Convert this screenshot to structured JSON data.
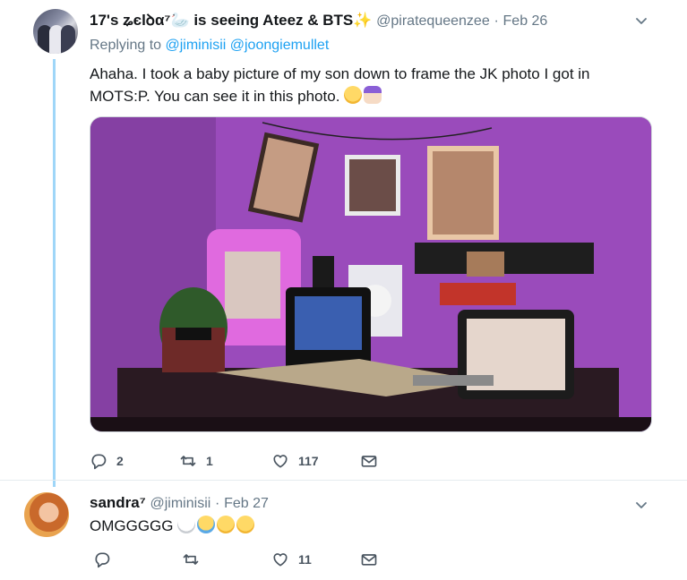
{
  "tweets": [
    {
      "display_name": "17's ʑєlꝺα⁷🦢 is seeing Ateez & BTS✨",
      "handle": "@piratequeenzee",
      "separator": "·",
      "date": "Feb 26",
      "replying_prefix": "Replying to",
      "replying_to": [
        "@jiminisii",
        "@joongiemullet"
      ],
      "text": "Ahaha. I took a baby picture of my son down to frame the JK photo I got in MOTS:P. You can see it in this photo.",
      "text_emojis": [
        "laughing-tears-emoji",
        "shrug-emoji"
      ],
      "actions": {
        "replies": "2",
        "retweets": "1",
        "likes": "117"
      }
    },
    {
      "display_name": "sandra⁷",
      "handle": "@jiminisii",
      "separator": "·",
      "date": "Feb 27",
      "text": "OMGGGGG",
      "text_emojis": [
        "skull-emoji",
        "crying-emoji",
        "laughing-tears-emoji",
        "laughing-tears-emoji"
      ],
      "actions": {
        "replies": "",
        "retweets": "",
        "likes": "11"
      }
    }
  ],
  "icons": {
    "reply": "reply-icon",
    "retweet": "retweet-icon",
    "like": "heart-icon",
    "dm": "envelope-icon",
    "menu": "chevron-down-icon"
  },
  "colors": {
    "link": "#1da1f2",
    "secondary_text": "#657786",
    "thread_line": "#9fd6f8"
  }
}
